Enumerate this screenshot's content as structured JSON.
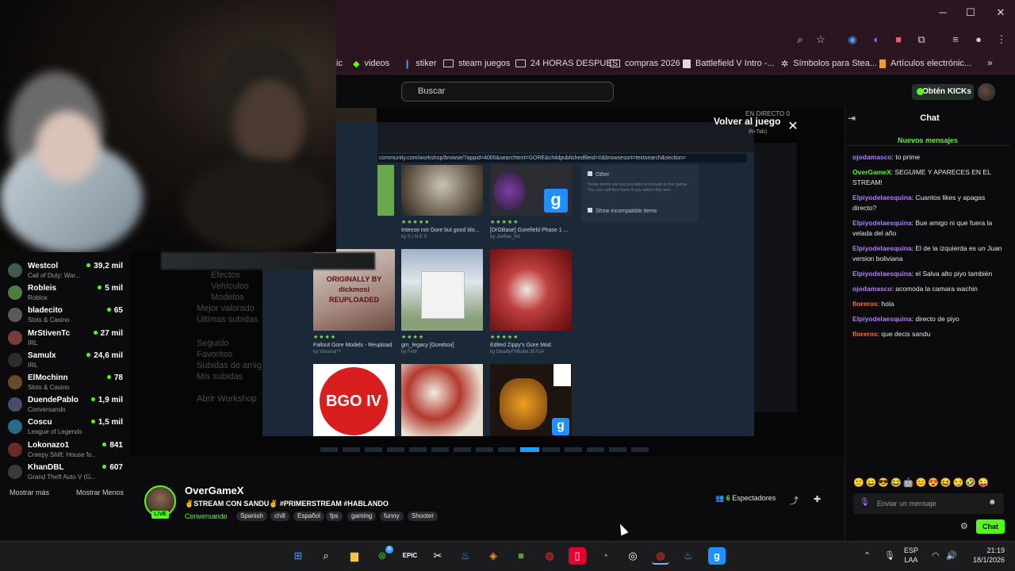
{
  "window": {
    "minimize": "─",
    "maximize": "☐",
    "close": "✕"
  },
  "bookmarks": [
    {
      "label": "ic",
      "icon": "folder-icon"
    },
    {
      "label": "videos",
      "icon": "kick-icon"
    },
    {
      "label": "stiker",
      "icon": "tag-icon"
    },
    {
      "label": "steam juegos",
      "icon": "folder-icon"
    },
    {
      "label": "24 HORAS DESPUES",
      "icon": "folder-icon"
    },
    {
      "label": "compras 2026",
      "icon": "folder-icon"
    },
    {
      "label": "Battlefield V Intro -...",
      "icon": "page-icon"
    },
    {
      "label": "Símbolos para Stea...",
      "icon": "gear-icon"
    },
    {
      "label": "Artículos electrónic...",
      "icon": "page-icon"
    }
  ],
  "header": {
    "search_placeholder": "Buscar",
    "get_kicks": "Obtén KICKs"
  },
  "sidebar": {
    "channels": [
      {
        "name": "Westcol",
        "category": "Call of Duty: War...",
        "viewers": "39,2 mil"
      },
      {
        "name": "Robleis",
        "category": "Roblox",
        "viewers": "5 mil"
      },
      {
        "name": "bladecito",
        "category": "Slots & Casino",
        "viewers": "65"
      },
      {
        "name": "MrStivenTc",
        "category": "IRL",
        "viewers": "27 mil"
      },
      {
        "name": "Samulx",
        "category": "IRL",
        "viewers": "24,6 mil"
      },
      {
        "name": "ElMochinn",
        "category": "Slots & Casino",
        "viewers": "78"
      },
      {
        "name": "DuendePablo",
        "category": "Conversando",
        "viewers": "1,9 mil"
      },
      {
        "name": "Coscu",
        "category": "League of Legends",
        "viewers": "1,5 mil"
      },
      {
        "name": "Lokonazo1",
        "category": "Creepy Shift: House fo...",
        "viewers": "841"
      },
      {
        "name": "KhanDBL",
        "category": "Grand Theft Auto V (G...",
        "viewers": "607"
      }
    ],
    "show_more": "Mostrar más",
    "show_less": "Mostrar Menos"
  },
  "player": {
    "back_to_game": "Volver al juego",
    "back_sub": "ift+Tab)",
    "live_label": "EN DIRECTO",
    "live_count": "0",
    "side_menu": [
      "Efectos",
      "Vehículos",
      "Modelos",
      "Mejor valorado",
      "Últimas subidas",
      "Seguido",
      "Favoritos",
      "Subidas de amig",
      "Mis subidas",
      "Abrir Workshop"
    ],
    "steam_url": "community.com/workshop/browse/?appid=4000&searchtext=GORE&childpublishedfileid=0&browsesort=textsearch&section=",
    "filter_other": "Other",
    "filter_note": "Some items are not possible to include in the game. You can still find them if you select this box.",
    "filter_show": "Show incompatible items",
    "items": [
      {
        "title": "Intense not Gore but good blo...",
        "author": "by S I N E S"
      },
      {
        "title": "[DrGBase] Gorefield Phase 1 ...",
        "author": "by Joeflax_N1"
      },
      {
        "title": "Fallout Gore Models - Reupload",
        "author": "by Visceral™"
      },
      {
        "title": "gm_legacy [Gorebox]",
        "author": "by Fetti"
      },
      {
        "title": "Edited Zippy's Gore Mod",
        "author": "by DeadlyFl!Bullet.357UA"
      }
    ],
    "tile_texts": {
      "reuploaded": "ORIGINALLY BY dickmosi REUPLOADED",
      "gore": "BGO IV",
      "gmod": "g"
    }
  },
  "stream": {
    "streamer": "OverGameX",
    "live_badge": "LIVE",
    "title": "✌STREAM CON SANDU✌ #PRIMERSTREAM #HABLANDO",
    "category": "Conversando",
    "tags": [
      "Spanish",
      "chill",
      "Español",
      "fps",
      "gaming",
      "funny",
      "Shooter"
    ],
    "viewers_count": "6",
    "viewers_label": "Espectadores"
  },
  "chat": {
    "title": "Chat",
    "new_messages": "Nuevos mensajes",
    "messages": [
      {
        "user": "ojodamasco",
        "text": "to prime",
        "color": "#b07cff"
      },
      {
        "user": "OverGameX",
        "text": "SEGUIME Y APARECES EN EL STREAM!",
        "color": "#53fc18"
      },
      {
        "user": "Elpiyodelaesquina",
        "text": "Cuantos likes y apagas directo?",
        "color": "#b07cff"
      },
      {
        "user": "Elpiyodelaesquina",
        "text": "Bue amigo ni que fuera la velada del año",
        "color": "#b07cff"
      },
      {
        "user": "Elpiyodelaesquina",
        "text": "El de la izquierda es un Juan version boliviana",
        "color": "#b07cff"
      },
      {
        "user": "Elpiyodelaesquina",
        "text": "el Salva alto piyo también",
        "color": "#b07cff"
      },
      {
        "user": "ojodamasco",
        "text": "acomoda la camara wachin",
        "color": "#b07cff"
      },
      {
        "user": "floreros",
        "text": "hola",
        "color": "#ff6b3d"
      },
      {
        "user": "Elpiyodelaesquina",
        "text": "directo de piyo",
        "color": "#b07cff"
      },
      {
        "user": "floreros",
        "text": "que decis sandu",
        "color": "#ff6b3d"
      }
    ],
    "input_placeholder": "Enviar un mensaje",
    "send_label": "Chat",
    "emotes": "🙂😄😎😂🤖😊😍😆😏🤣😜"
  },
  "taskbar": {
    "lang_top": "ESP",
    "lang_bottom": "LAA",
    "time": "21:19",
    "date": "18/1/2026",
    "xbox_badge": "8"
  },
  "colors": {
    "accent": "#53fc18",
    "browser": "#2a1521",
    "steam": "#1b2838"
  }
}
